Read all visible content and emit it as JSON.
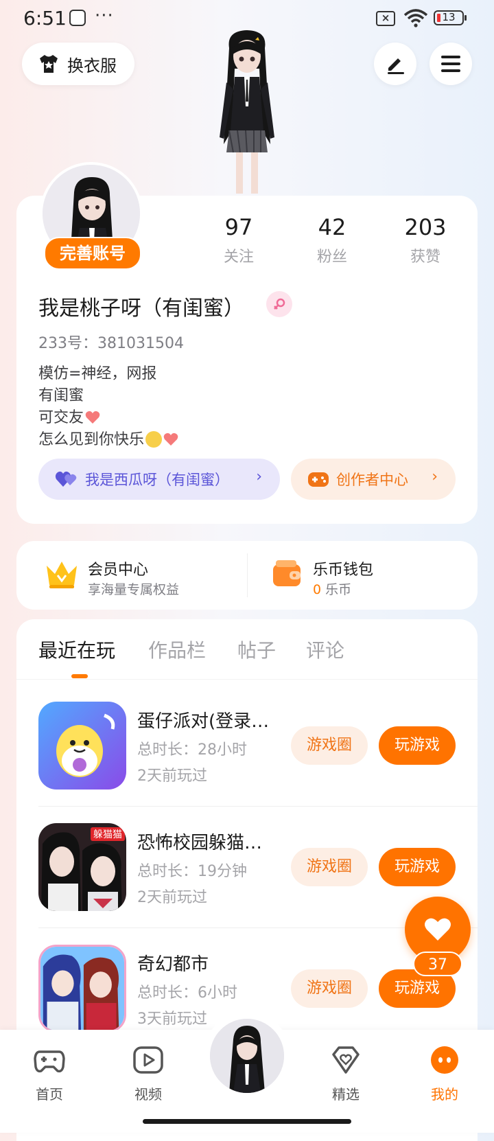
{
  "status_bar": {
    "time": "6:51",
    "dots": "···",
    "battery": "13"
  },
  "header": {
    "dress_up_label": "换衣服"
  },
  "profile": {
    "complete_badge": "完善账号",
    "stats": [
      {
        "value": "97",
        "label": "关注"
      },
      {
        "value": "42",
        "label": "粉丝"
      },
      {
        "value": "203",
        "label": "获赞"
      }
    ],
    "nickname": "我是桃子呀（有闺蜜）",
    "uid": "233号：381031504",
    "bio": [
      "模仿=神经，网报",
      "有闺蜜",
      "可交友",
      "怎么见到你快乐"
    ],
    "friend_pill": "我是西瓜呀（有闺蜜）",
    "creator_pill": "创作者中心",
    "chevron": "›"
  },
  "member": {
    "title": "会员中心",
    "subtitle": "享海量专属权益",
    "wallet_title": "乐币钱包",
    "wallet_amount": "0",
    "wallet_unit": "乐币"
  },
  "tabs": [
    "最近在玩",
    "作品栏",
    "帖子",
    "评论"
  ],
  "games": [
    {
      "name": "蛋仔派对(登录…",
      "duration": "总时长：28小时",
      "last_played": "2天前玩过"
    },
    {
      "name": "恐怖校园躲猫…",
      "duration": "总时长：19分钟",
      "last_played": "2天前玩过"
    },
    {
      "name": "奇幻都市",
      "duration": "总时长：6小时",
      "last_played": "3天前玩过"
    }
  ],
  "buttons": {
    "game_circle": "游戏圈",
    "play": "玩游戏"
  },
  "game2_banner": "躲猫猫",
  "like": {
    "count": "37"
  },
  "bottom_nav": [
    {
      "label": "首页",
      "icon": "gamepad-icon"
    },
    {
      "label": "视频",
      "icon": "video-icon"
    },
    {
      "label": "精选",
      "icon": "heart-gem-icon"
    },
    {
      "label": "我的",
      "icon": "profile-face-icon"
    }
  ],
  "colors": {
    "accent": "#ff7300",
    "purple": "#5b55d8"
  }
}
